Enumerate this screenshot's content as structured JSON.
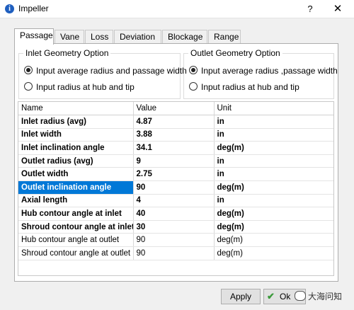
{
  "window": {
    "title": "Impeller",
    "help": "?",
    "close": "✕"
  },
  "tabs": [
    {
      "label": "Passage"
    },
    {
      "label": "Vane"
    },
    {
      "label": "Loss"
    },
    {
      "label": "Deviation"
    },
    {
      "label": "Blockage"
    },
    {
      "label": "Range"
    }
  ],
  "inlet": {
    "title": "Inlet Geometry Option",
    "option1": "Input average radius and passage width",
    "option2": "Input radius at hub and tip",
    "selected": 1
  },
  "outlet": {
    "title": "Outlet Geometry Option",
    "option1": "Input average radius ,passage width",
    "option2": "Input radius at hub and tip",
    "selected": 1
  },
  "table": {
    "headers": {
      "name": "Name",
      "value": "Value",
      "unit": "Unit"
    },
    "rows": [
      {
        "name": "Inlet radius (avg)",
        "value": "4.87",
        "unit": "in",
        "bold": true
      },
      {
        "name": "Inlet width",
        "value": "3.88",
        "unit": "in",
        "bold": true
      },
      {
        "name": "Inlet inclination angle",
        "value": "34.1",
        "unit": "deg(m)",
        "bold": true
      },
      {
        "name": "Outlet radius (avg)",
        "value": "9",
        "unit": "in",
        "bold": true
      },
      {
        "name": "Outlet width",
        "value": "2.75",
        "unit": "in",
        "bold": true
      },
      {
        "name": "Outlet inclination angle",
        "value": "90",
        "unit": "deg(m)",
        "bold": true,
        "selected": true
      },
      {
        "name": "Axial length",
        "value": "4",
        "unit": "in",
        "bold": true
      },
      {
        "name": "Hub contour angle at inlet",
        "value": "40",
        "unit": "deg(m)",
        "bold": true
      },
      {
        "name": "Shroud contour angle at inlet",
        "value": "30",
        "unit": "deg(m)",
        "bold": true
      },
      {
        "name": "Hub contour angle at outlet",
        "value": "90",
        "unit": "deg(m)",
        "bold": false
      },
      {
        "name": "Shroud contour angle at outlet",
        "value": "90",
        "unit": "deg(m)",
        "bold": false
      }
    ]
  },
  "buttons": {
    "apply": "Apply",
    "ok": "Ok"
  },
  "watermark": "大海问知",
  "colors": {
    "selection": "#0078d7",
    "check": "#3a9a3a"
  }
}
